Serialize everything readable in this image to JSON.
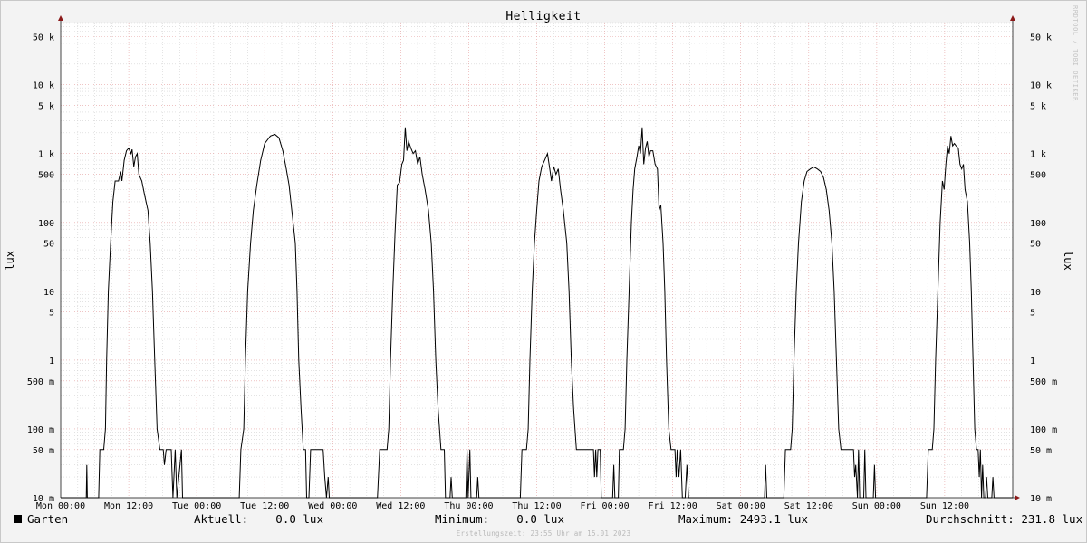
{
  "watermark": "RRDTOOL / TOBI OETIKER",
  "footer": "Erstellungszeit: 23:55 Uhr am 15.01.2023",
  "legend": {
    "series_name": "Garten",
    "current": "Aktuell:    0.0 lux",
    "minimum": "Minimum:    0.0 lux",
    "maximum": "Maximum: 2493.1 lux",
    "average": "Durchschnitt: 231.8 lux"
  },
  "colors": {
    "line": "#000000",
    "grid_major": "#e5a0a0",
    "grid_minor": "#d2d2d2",
    "background": "#ffffff",
    "canvas": "#f3f3f3",
    "arrow": "#8b1a1a"
  },
  "chart_data": {
    "type": "line",
    "title": "Helligkeit",
    "ylabel": "lux",
    "yscale": "log",
    "ylim": [
      0.01,
      80000
    ],
    "xlim": [
      0,
      168
    ],
    "x_unit": "hours since Mon 00:00",
    "grid": true,
    "y_tick_labels": [
      {
        "value": 50000,
        "label": "50 k"
      },
      {
        "value": 10000,
        "label": "10 k"
      },
      {
        "value": 5000,
        "label": "5 k"
      },
      {
        "value": 1000,
        "label": "1 k"
      },
      {
        "value": 500,
        "label": "500"
      },
      {
        "value": 100,
        "label": "100"
      },
      {
        "value": 50,
        "label": "50"
      },
      {
        "value": 10,
        "label": "10"
      },
      {
        "value": 5,
        "label": "5"
      },
      {
        "value": 1,
        "label": "1"
      },
      {
        "value": 0.5,
        "label": "500 m"
      },
      {
        "value": 0.1,
        "label": "100 m"
      },
      {
        "value": 0.05,
        "label": "50 m"
      },
      {
        "value": 0.01,
        "label": "10 m"
      }
    ],
    "x_tick_labels": [
      {
        "value": 0,
        "label": "Mon 00:00"
      },
      {
        "value": 12,
        "label": "Mon 12:00"
      },
      {
        "value": 24,
        "label": "Tue 00:00"
      },
      {
        "value": 36,
        "label": "Tue 12:00"
      },
      {
        "value": 48,
        "label": "Wed 00:00"
      },
      {
        "value": 60,
        "label": "Wed 12:00"
      },
      {
        "value": 72,
        "label": "Thu 00:00"
      },
      {
        "value": 84,
        "label": "Thu 12:00"
      },
      {
        "value": 96,
        "label": "Fri 00:00"
      },
      {
        "value": 108,
        "label": "Fri 12:00"
      },
      {
        "value": 120,
        "label": "Sat 00:00"
      },
      {
        "value": 132,
        "label": "Sat 12:00"
      },
      {
        "value": 144,
        "label": "Sun 00:00"
      },
      {
        "value": 156,
        "label": "Sun 12:00"
      }
    ],
    "series": [
      {
        "name": "Garten",
        "points": [
          [
            0,
            0.01
          ],
          [
            4.5,
            0.01
          ],
          [
            4.6,
            0.03
          ],
          [
            4.7,
            0.01
          ],
          [
            6.7,
            0.01
          ],
          [
            6.9,
            0.05
          ],
          [
            7.6,
            0.05
          ],
          [
            7.9,
            0.1
          ],
          [
            8.1,
            1
          ],
          [
            8.4,
            10
          ],
          [
            8.8,
            50
          ],
          [
            9.2,
            200
          ],
          [
            9.6,
            400
          ],
          [
            10.2,
            400
          ],
          [
            10.6,
            550
          ],
          [
            10.8,
            400
          ],
          [
            11.2,
            800
          ],
          [
            11.6,
            1100
          ],
          [
            12,
            1200
          ],
          [
            12.4,
            1000
          ],
          [
            12.6,
            1150
          ],
          [
            12.9,
            650
          ],
          [
            13.2,
            900
          ],
          [
            13.5,
            1000
          ],
          [
            13.8,
            500
          ],
          [
            14.3,
            400
          ],
          [
            14.8,
            250
          ],
          [
            15.4,
            150
          ],
          [
            15.8,
            50
          ],
          [
            16.2,
            10
          ],
          [
            16.6,
            1
          ],
          [
            17,
            0.1
          ],
          [
            17.5,
            0.05
          ],
          [
            18.1,
            0.05
          ],
          [
            18.3,
            0.03
          ],
          [
            18.6,
            0.05
          ],
          [
            19.5,
            0.05
          ],
          [
            19.8,
            0.01
          ],
          [
            20.2,
            0.05
          ],
          [
            20.5,
            0.01
          ],
          [
            21.3,
            0.05
          ],
          [
            21.5,
            0.01
          ],
          [
            31.5,
            0.01
          ],
          [
            31.8,
            0.05
          ],
          [
            32.3,
            0.1
          ],
          [
            32.6,
            1
          ],
          [
            33,
            10
          ],
          [
            33.5,
            50
          ],
          [
            34,
            150
          ],
          [
            34.6,
            350
          ],
          [
            35.3,
            800
          ],
          [
            36,
            1400
          ],
          [
            37,
            1800
          ],
          [
            37.8,
            1900
          ],
          [
            38.5,
            1700
          ],
          [
            39.2,
            1100
          ],
          [
            39.8,
            600
          ],
          [
            40.3,
            350
          ],
          [
            40.9,
            120
          ],
          [
            41.4,
            50
          ],
          [
            41.7,
            10
          ],
          [
            42,
            1
          ],
          [
            42.4,
            0.2
          ],
          [
            42.8,
            0.05
          ],
          [
            43.2,
            0.05
          ],
          [
            43.4,
            0.01
          ],
          [
            43.8,
            0.01
          ],
          [
            44.1,
            0.05
          ],
          [
            46.3,
            0.05
          ],
          [
            46.6,
            0.02
          ],
          [
            46.9,
            0.01
          ],
          [
            47.2,
            0.02
          ],
          [
            47.4,
            0.01
          ],
          [
            55.9,
            0.01
          ],
          [
            56.3,
            0.05
          ],
          [
            57.6,
            0.05
          ],
          [
            57.9,
            0.1
          ],
          [
            58.2,
            1
          ],
          [
            58.6,
            10
          ],
          [
            59,
            70
          ],
          [
            59.4,
            350
          ],
          [
            59.8,
            380
          ],
          [
            60.2,
            700
          ],
          [
            60.5,
            800
          ],
          [
            60.8,
            2400
          ],
          [
            61.1,
            1100
          ],
          [
            61.4,
            1500
          ],
          [
            61.8,
            1200
          ],
          [
            62.2,
            1000
          ],
          [
            62.6,
            1100
          ],
          [
            63,
            700
          ],
          [
            63.4,
            900
          ],
          [
            63.8,
            500
          ],
          [
            64.3,
            300
          ],
          [
            64.9,
            150
          ],
          [
            65.4,
            50
          ],
          [
            65.8,
            10
          ],
          [
            66.2,
            1
          ],
          [
            66.6,
            0.2
          ],
          [
            67.1,
            0.05
          ],
          [
            67.7,
            0.05
          ],
          [
            67.9,
            0.01
          ],
          [
            68.7,
            0.01
          ],
          [
            68.9,
            0.02
          ],
          [
            69.1,
            0.01
          ],
          [
            71.5,
            0.01
          ],
          [
            71.7,
            0.05
          ],
          [
            71.9,
            0.01
          ],
          [
            72.2,
            0.05
          ],
          [
            72.4,
            0.01
          ],
          [
            73.4,
            0.01
          ],
          [
            73.6,
            0.02
          ],
          [
            73.8,
            0.01
          ],
          [
            81.1,
            0.01
          ],
          [
            81.4,
            0.05
          ],
          [
            82.2,
            0.05
          ],
          [
            82.5,
            0.1
          ],
          [
            82.8,
            1
          ],
          [
            83.2,
            10
          ],
          [
            83.6,
            50
          ],
          [
            84,
            150
          ],
          [
            84.4,
            400
          ],
          [
            84.9,
            650
          ],
          [
            85.4,
            800
          ],
          [
            85.9,
            1000
          ],
          [
            86.3,
            600
          ],
          [
            86.6,
            400
          ],
          [
            87,
            650
          ],
          [
            87.4,
            500
          ],
          [
            87.8,
            600
          ],
          [
            88.2,
            300
          ],
          [
            88.7,
            150
          ],
          [
            89.3,
            50
          ],
          [
            89.7,
            10
          ],
          [
            90.1,
            1
          ],
          [
            90.5,
            0.2
          ],
          [
            91,
            0.05
          ],
          [
            94,
            0.05
          ],
          [
            94.2,
            0.02
          ],
          [
            94.4,
            0.05
          ],
          [
            94.6,
            0.02
          ],
          [
            94.8,
            0.05
          ],
          [
            95.2,
            0.05
          ],
          [
            95.4,
            0.01
          ],
          [
            97.4,
            0.01
          ],
          [
            97.6,
            0.03
          ],
          [
            97.8,
            0.01
          ],
          [
            98.4,
            0.01
          ],
          [
            98.6,
            0.05
          ],
          [
            99.3,
            0.05
          ],
          [
            99.6,
            0.1
          ],
          [
            99.9,
            1
          ],
          [
            100.3,
            10
          ],
          [
            100.7,
            100
          ],
          [
            101,
            300
          ],
          [
            101.3,
            600
          ],
          [
            101.7,
            900
          ],
          [
            102,
            1300
          ],
          [
            102.3,
            1000
          ],
          [
            102.6,
            2400
          ],
          [
            102.9,
            700
          ],
          [
            103.2,
            1200
          ],
          [
            103.5,
            1500
          ],
          [
            103.8,
            900
          ],
          [
            104.1,
            1100
          ],
          [
            104.5,
            1100
          ],
          [
            104.9,
            700
          ],
          [
            105.3,
            600
          ],
          [
            105.6,
            150
          ],
          [
            105.9,
            180
          ],
          [
            106.3,
            50
          ],
          [
            106.6,
            10
          ],
          [
            106.9,
            1
          ],
          [
            107.3,
            0.1
          ],
          [
            107.7,
            0.05
          ],
          [
            108.4,
            0.05
          ],
          [
            108.6,
            0.02
          ],
          [
            108.8,
            0.05
          ],
          [
            109.1,
            0.02
          ],
          [
            109.4,
            0.05
          ],
          [
            109.7,
            0.01
          ],
          [
            110.2,
            0.01
          ],
          [
            110.5,
            0.03
          ],
          [
            110.8,
            0.01
          ],
          [
            124.2,
            0.01
          ],
          [
            124.4,
            0.03
          ],
          [
            124.6,
            0.01
          ],
          [
            127.6,
            0.01
          ],
          [
            127.9,
            0.05
          ],
          [
            128.8,
            0.05
          ],
          [
            129.1,
            0.1
          ],
          [
            129.4,
            1
          ],
          [
            129.8,
            10
          ],
          [
            130.2,
            50
          ],
          [
            130.7,
            200
          ],
          [
            131.2,
            400
          ],
          [
            131.7,
            550
          ],
          [
            132.3,
            600
          ],
          [
            132.9,
            640
          ],
          [
            133.5,
            600
          ],
          [
            134.1,
            550
          ],
          [
            134.6,
            450
          ],
          [
            135.1,
            300
          ],
          [
            135.6,
            150
          ],
          [
            136.1,
            50
          ],
          [
            136.5,
            10
          ],
          [
            136.9,
            1
          ],
          [
            137.3,
            0.1
          ],
          [
            137.7,
            0.05
          ],
          [
            139.9,
            0.05
          ],
          [
            140.1,
            0.02
          ],
          [
            140.3,
            0.03
          ],
          [
            140.6,
            0.01
          ],
          [
            140.8,
            0.05
          ],
          [
            141,
            0.01
          ],
          [
            141.7,
            0.01
          ],
          [
            141.9,
            0.05
          ],
          [
            142.1,
            0.01
          ],
          [
            143.4,
            0.01
          ],
          [
            143.6,
            0.03
          ],
          [
            143.8,
            0.01
          ],
          [
            152.8,
            0.01
          ],
          [
            153.1,
            0.05
          ],
          [
            153.8,
            0.05
          ],
          [
            154.1,
            0.1
          ],
          [
            154.4,
            1
          ],
          [
            154.8,
            10
          ],
          [
            155.2,
            100
          ],
          [
            155.6,
            400
          ],
          [
            155.9,
            300
          ],
          [
            156.2,
            700
          ],
          [
            156.5,
            1300
          ],
          [
            156.8,
            1000
          ],
          [
            157.1,
            1800
          ],
          [
            157.4,
            1300
          ],
          [
            157.7,
            1400
          ],
          [
            158,
            1300
          ],
          [
            158.4,
            1200
          ],
          [
            158.7,
            700
          ],
          [
            159,
            600
          ],
          [
            159.3,
            700
          ],
          [
            159.6,
            300
          ],
          [
            160,
            200
          ],
          [
            160.4,
            50
          ],
          [
            160.7,
            10
          ],
          [
            161,
            1
          ],
          [
            161.3,
            0.1
          ],
          [
            161.6,
            0.05
          ],
          [
            161.9,
            0.05
          ],
          [
            162.1,
            0.02
          ],
          [
            162.3,
            0.05
          ],
          [
            162.5,
            0.01
          ],
          [
            162.7,
            0.03
          ],
          [
            162.9,
            0.01
          ],
          [
            163.2,
            0.01
          ],
          [
            163.4,
            0.02
          ],
          [
            163.6,
            0.01
          ],
          [
            164.3,
            0.01
          ],
          [
            164.5,
            0.02
          ],
          [
            164.7,
            0.01
          ],
          [
            168,
            0.01
          ]
        ]
      }
    ]
  }
}
